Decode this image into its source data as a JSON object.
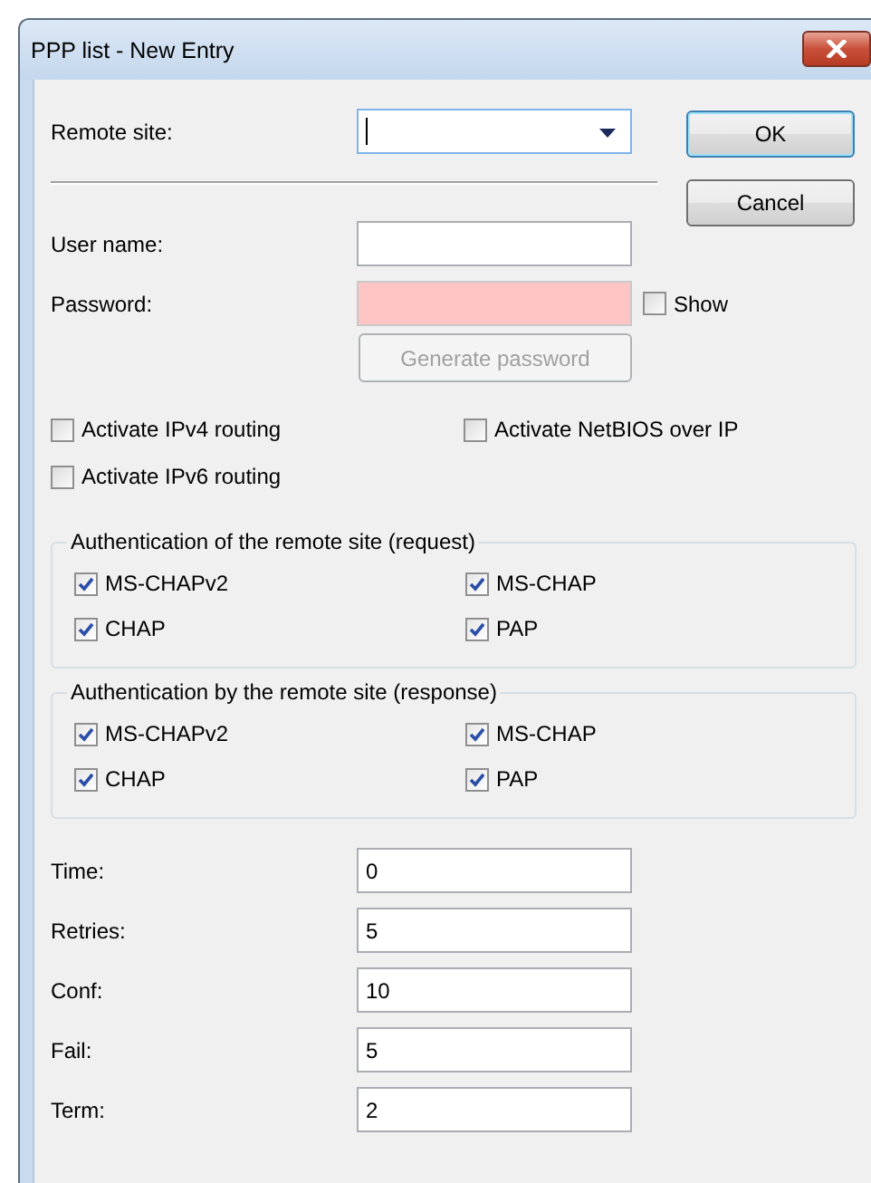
{
  "window": {
    "title": "PPP list - New Entry"
  },
  "remote_site": {
    "label": "Remote site:",
    "focused": true
  },
  "buttons": [
    {
      "label": "OK",
      "default": true
    },
    {
      "label": "Cancel",
      "default": false
    }
  ],
  "user_name": {
    "label": "User name:"
  },
  "password": {
    "label": "Password:",
    "invalid": true
  },
  "show_password": {
    "label": "Show",
    "checked": false
  },
  "generate_button": {
    "label": "Generate password",
    "disabled": true
  },
  "options": [
    {
      "label": "Activate IPv4 routing",
      "checked": false
    },
    {
      "label": "Activate NetBIOS over IP",
      "checked": false
    },
    {
      "label": "Activate IPv6 routing",
      "checked": false
    }
  ],
  "auth_groups": [
    {
      "title": "Authentication of the remote site (request)",
      "methods": [
        {
          "label": "MS-CHAPv2",
          "checked": true
        },
        {
          "label": "MS-CHAP",
          "checked": true
        },
        {
          "label": "CHAP",
          "checked": true
        },
        {
          "label": "PAP",
          "checked": true
        }
      ]
    },
    {
      "title": "Authentication by the remote site (response)",
      "methods": [
        {
          "label": "MS-CHAPv2",
          "checked": true
        },
        {
          "label": "MS-CHAP",
          "checked": true
        },
        {
          "label": "CHAP",
          "checked": true
        },
        {
          "label": "PAP",
          "checked": true
        }
      ]
    }
  ],
  "timers": [
    {
      "label": "Time:",
      "value": "0"
    },
    {
      "label": "Retries:",
      "value": "5"
    },
    {
      "label": "Conf:",
      "value": "10"
    },
    {
      "label": "Fail:",
      "value": "5"
    },
    {
      "label": "Term:",
      "value": "2"
    }
  ]
}
